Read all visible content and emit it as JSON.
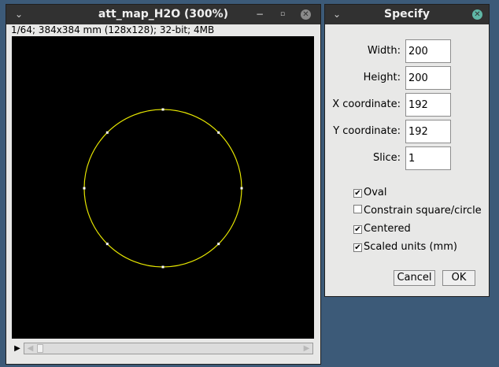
{
  "image_window": {
    "title": "att_map_H2O (300%)",
    "info": "1/64; 384x384 mm (128x128); 32-bit; 4MB",
    "menu_icon": "chevron-down-icon",
    "minimize_icon": "minimize-icon",
    "maximize_icon": "maximize-icon",
    "close_icon": "close-icon",
    "play_icon": "play-icon",
    "roi": {
      "shape": "oval",
      "color": "#e6e600",
      "handle_color": "#ffffff"
    }
  },
  "specify_dialog": {
    "title": "Specify",
    "menu_icon": "chevron-down-icon",
    "close_icon": "close-icon",
    "close_color": "#5fb7a6",
    "fields": [
      {
        "label": "Width:",
        "value": "200"
      },
      {
        "label": "Height:",
        "value": "200"
      },
      {
        "label": "X coordinate:",
        "value": "192"
      },
      {
        "label": "Y coordinate:",
        "value": "192"
      },
      {
        "label": "Slice:",
        "value": "1"
      }
    ],
    "checkboxes": [
      {
        "label": "Oval",
        "checked": true
      },
      {
        "label": "Constrain square/circle",
        "checked": false
      },
      {
        "label": "Centered",
        "checked": true
      },
      {
        "label": "Scaled units (mm)",
        "checked": true
      }
    ],
    "cancel_label": "Cancel",
    "ok_label": "OK"
  }
}
